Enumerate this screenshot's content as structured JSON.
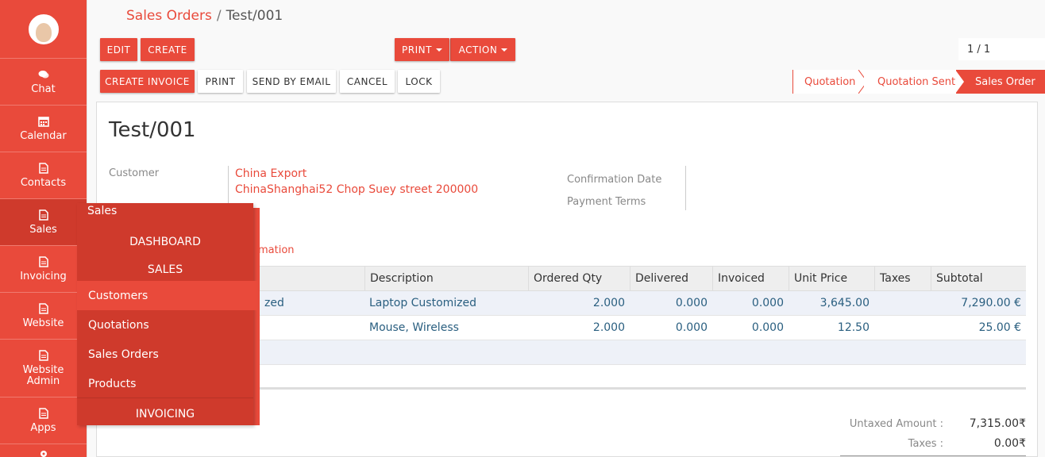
{
  "sidebar": {
    "items": [
      {
        "label": "Chat",
        "icon": "chat-icon"
      },
      {
        "label": "Calendar",
        "icon": "calendar-icon"
      },
      {
        "label": "Contacts",
        "icon": "document-icon"
      },
      {
        "label": "Sales",
        "icon": "document-icon"
      },
      {
        "label": "Invoicing",
        "icon": "document-icon"
      },
      {
        "label": "Website",
        "icon": "document-icon"
      },
      {
        "label": "Website Admin",
        "icon": "document-icon"
      },
      {
        "label": "Apps",
        "icon": "document-icon"
      }
    ]
  },
  "breadcrumb": {
    "parent": "Sales Orders",
    "separator": "/",
    "current": "Test/001"
  },
  "toolbar": {
    "edit": "EDIT",
    "create": "CREATE",
    "print": "PRINT",
    "action": "ACTION",
    "pager": "1 / 1"
  },
  "actions": {
    "create_invoice": "CREATE INVOICE",
    "print": "PRINT",
    "send_email": "SEND BY EMAIL",
    "cancel": "CANCEL",
    "lock": "LOCK"
  },
  "status": {
    "stages": [
      "Quotation",
      "Quotation Sent",
      "Sales Order"
    ],
    "active": "Sales Order"
  },
  "form": {
    "title": "Test/001",
    "customer_label": "Customer",
    "customer_name": "China Export",
    "customer_address": "ChinaShanghai52 Chop Suey street 200000",
    "confirmation_date_label": "Confirmation Date",
    "payment_terms_label": "Payment Terms",
    "tab_fragment": "mation"
  },
  "order_lines": {
    "columns": [
      "Description",
      "Ordered Qty",
      "Delivered",
      "Invoiced",
      "Unit Price",
      "Taxes",
      "Subtotal"
    ],
    "rows": [
      {
        "product_fragment": "zed",
        "description": "Laptop Customized",
        "qty": "2.000",
        "delivered": "0.000",
        "invoiced": "0.000",
        "unit_price": "3,645.00",
        "taxes": "",
        "subtotal": "7,290.00 €"
      },
      {
        "product_fragment": "",
        "description": "Mouse, Wireless",
        "qty": "2.000",
        "delivered": "0.000",
        "invoiced": "0.000",
        "unit_price": "12.50",
        "taxes": "",
        "subtotal": "25.00 €"
      }
    ]
  },
  "totals": {
    "untaxed_label": "Untaxed Amount :",
    "untaxed_value": "7,315.00₹",
    "taxes_label": "Taxes :",
    "taxes_value": "0.00₹"
  },
  "menu": {
    "title": "Sales",
    "section_dashboard": "DASHBOARD",
    "section_sales": "SALES",
    "items": [
      "Customers",
      "Quotations",
      "Sales Orders",
      "Products"
    ],
    "section_invoicing": "INVOICING"
  },
  "colors": {
    "accent": "#e94a3b",
    "accent_dark": "#cf3a2c",
    "link_blue": "#2a5f80"
  }
}
